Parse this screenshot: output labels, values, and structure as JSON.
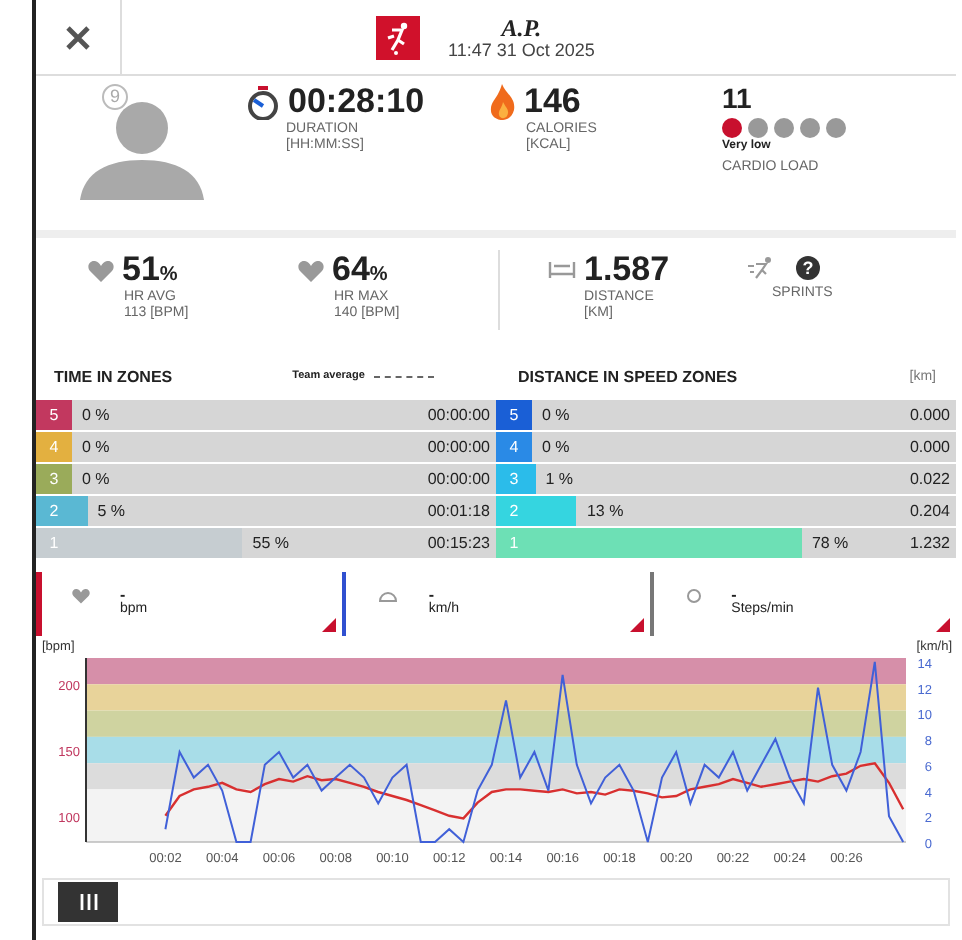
{
  "header": {
    "initials": "A.P.",
    "datetime": "11:47 31 Oct 2025"
  },
  "player": {
    "number": "9"
  },
  "duration": {
    "value": "00:28:10",
    "label": "DURATION",
    "unit": "[HH:MM:SS]"
  },
  "calories": {
    "value": "146",
    "label": "CALORIES",
    "unit": "[KCAL]"
  },
  "cardio_load": {
    "value": "11",
    "rating": "Very low",
    "label": "CARDIO LOAD",
    "dots": [
      {
        "on": true
      },
      {
        "on": false
      },
      {
        "on": false
      },
      {
        "on": false
      },
      {
        "on": false
      }
    ]
  },
  "metrics": [
    {
      "kind": "hr",
      "value": "51",
      "suffix": "%",
      "label": "HR AVG",
      "sub": "113 [BPM]"
    },
    {
      "kind": "hr",
      "value": "64",
      "suffix": "%",
      "label": "HR MAX",
      "sub": "140 [BPM]"
    },
    {
      "kind": "distance",
      "value": "1.587",
      "label": "DISTANCE",
      "sub": "[KM]"
    },
    {
      "kind": "sprints",
      "value": "?",
      "label": "SPRINTS"
    }
  ],
  "time_in_zones": {
    "title": "TIME IN ZONES",
    "team_average": "Team average",
    "rows": [
      {
        "zone": "5",
        "percent": "0 %",
        "time": "00:00:00",
        "color": "#c2385f"
      },
      {
        "zone": "4",
        "percent": "0 %",
        "time": "00:00:00",
        "color": "#e3b040"
      },
      {
        "zone": "3",
        "percent": "0 %",
        "time": "00:00:00",
        "color": "#9aab5a"
      },
      {
        "zone": "2",
        "percent": "5 %",
        "time": "00:01:18",
        "color": "#5ab8d3"
      },
      {
        "zone": "1",
        "percent": "55 %",
        "time": "00:15:23",
        "color": "#c6cdd1"
      }
    ]
  },
  "speed_zones": {
    "title": "DISTANCE IN SPEED ZONES",
    "unit": "[km]",
    "rows": [
      {
        "zone": "5",
        "percent": "0 %",
        "distance": "0.000",
        "color": "#1a5fd6"
      },
      {
        "zone": "4",
        "percent": "0 %",
        "distance": "0.000",
        "color": "#2a8ae6"
      },
      {
        "zone": "3",
        "percent": "1 %",
        "distance": "0.022",
        "color": "#2bbcea"
      },
      {
        "zone": "2",
        "percent": "13 %",
        "distance": "0.204",
        "color": "#35d5e0"
      },
      {
        "zone": "1",
        "percent": "78 %",
        "distance": "1.232",
        "color": "#6de0b5"
      }
    ]
  },
  "sensors": [
    {
      "kind": "heart",
      "value": "-",
      "unit": "bpm",
      "color": "#c8102e"
    },
    {
      "kind": "speed",
      "value": "-",
      "unit": "km/h",
      "color": "#3050d0"
    },
    {
      "kind": "steps",
      "value": "-",
      "unit": "Steps/min",
      "color": "#777777"
    }
  ],
  "chart_data": {
    "type": "line",
    "ylabel": "[bpm]",
    "y2label": "[km/h]",
    "x": [
      2,
      2.5,
      3,
      3.5,
      4,
      4.5,
      5,
      5.5,
      6,
      6.5,
      7,
      7.5,
      8,
      8.5,
      9,
      9.5,
      10,
      10.5,
      11,
      11.5,
      12,
      12.5,
      13,
      13.5,
      14,
      14.5,
      15,
      15.5,
      16,
      16.5,
      17,
      17.5,
      18,
      18.5,
      19,
      19.5,
      20,
      20.5,
      21,
      21.5,
      22,
      22.5,
      23,
      23.5,
      24,
      24.5,
      25,
      25.5,
      26,
      26.5,
      27,
      27.5,
      28
    ],
    "series": [
      {
        "color": "#d83030",
        "values": [
          100,
          115,
          120,
          122,
          125,
          120,
          118,
          124,
          128,
          126,
          130,
          127,
          128,
          125,
          122,
          118,
          115,
          112,
          108,
          104,
          100,
          98,
          110,
          118,
          120,
          120,
          119,
          118,
          120,
          117,
          118,
          116,
          120,
          119,
          117,
          114,
          115,
          120,
          122,
          124,
          128,
          125,
          122,
          124,
          126,
          128,
          126,
          130,
          132,
          138,
          140,
          125,
          105
        ]
      },
      {
        "color": "#4060d8",
        "axis": "y2",
        "values": [
          1,
          7,
          5,
          6,
          4,
          0,
          0,
          6,
          7,
          5,
          6,
          4,
          5,
          6,
          5,
          3,
          5,
          6,
          0,
          0,
          1,
          0,
          4,
          6,
          11,
          5,
          7,
          4,
          13,
          6,
          3,
          5,
          6,
          4,
          0,
          5,
          7,
          3,
          6,
          5,
          7,
          4,
          6,
          8,
          5,
          3,
          12,
          6,
          4,
          7,
          14,
          2,
          0
        ]
      }
    ],
    "xlim": [
      -0.8,
      28.1
    ],
    "ylim": [
      80,
      220
    ],
    "y2lim": [
      0,
      14.3
    ],
    "xticks": [
      {
        "value": 2,
        "label": "00:02"
      },
      {
        "value": 4,
        "label": "00:04"
      },
      {
        "value": 6,
        "label": "00:06"
      },
      {
        "value": 8,
        "label": "00:08"
      },
      {
        "value": 10,
        "label": "00:10"
      },
      {
        "value": 12,
        "label": "00:12"
      },
      {
        "value": 14,
        "label": "00:14"
      },
      {
        "value": 16,
        "label": "00:16"
      },
      {
        "value": 18,
        "label": "00:18"
      },
      {
        "value": 20,
        "label": "00:20"
      },
      {
        "value": 22,
        "label": "00:22"
      },
      {
        "value": 24,
        "label": "00:24"
      },
      {
        "value": 26,
        "label": "00:26"
      }
    ],
    "yticks": [
      100,
      150,
      200
    ],
    "y2ticks": [
      0,
      2,
      4,
      6,
      8,
      10,
      12,
      14
    ],
    "bands": [
      {
        "axis": "y",
        "from": 200,
        "to": 220,
        "color": "#d68fa9"
      },
      {
        "axis": "y",
        "from": 180,
        "to": 200,
        "color": "#e8d39a"
      },
      {
        "axis": "y",
        "from": 160,
        "to": 180,
        "color": "#cfd3a0"
      },
      {
        "axis": "y",
        "from": 140,
        "to": 160,
        "color": "#a8dde8"
      },
      {
        "axis": "y",
        "from": 120,
        "to": 140,
        "color": "#dcdcdc"
      },
      {
        "axis": "y",
        "from": 80,
        "to": 120,
        "color": "#f3f3f3"
      }
    ]
  }
}
